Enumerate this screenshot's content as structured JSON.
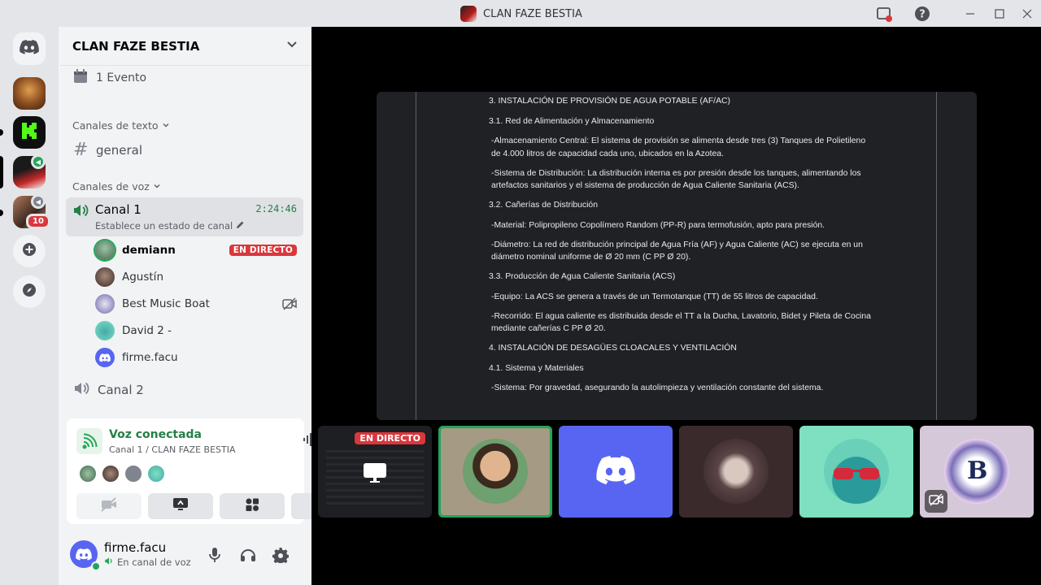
{
  "window": {
    "title": "CLAN FAZE BESTIA"
  },
  "server": {
    "name": "CLAN FAZE BESTIA",
    "events": "1 Evento",
    "text_category": "Canales de texto",
    "text_channels": [
      {
        "name": "general"
      }
    ],
    "voice_category": "Canales de voz",
    "voice_channels": [
      {
        "name": "Canal 1",
        "status": "Establece un estado de canal",
        "elapsed": "2:24:46"
      },
      {
        "name": "Canal 2"
      }
    ],
    "members": [
      {
        "name": "demiann",
        "live": "EN DIRECTO",
        "speaking": true
      },
      {
        "name": "Agustín"
      },
      {
        "name": "Best Music Boat",
        "video_off": true
      },
      {
        "name": "David 2 -"
      },
      {
        "name": "firme.facu"
      }
    ]
  },
  "rail": {
    "unread_badge": "10"
  },
  "voice_panel": {
    "title": "Voz conectada",
    "subtitle": "Canal 1 / CLAN FAZE BESTIA"
  },
  "user": {
    "name": "firme.facu",
    "status": "En canal de voz"
  },
  "stage": {
    "live_label": "EN DIRECTO",
    "document_lines": [
      "3. INSTALACIÓN DE PROVISIÓN DE AGUA POTABLE (AF/AC)",
      "3.1. Red de Alimentación y Almacenamiento",
      "-Almacenamiento Central: El sistema de provisión se alimenta desde tres (3) Tanques de Polietileno de 4.000 litros de capacidad cada uno, ubicados en la Azotea.",
      "-Sistema de Distribución: La distribución interna es por presión desde los tanques, alimentando los artefactos sanitarios y el sistema de producción de Agua Caliente Sanitaria (ACS).",
      "3.2. Cañerías de Distribución",
      "-Material: Polipropileno Copolímero Random (PP-R) para termofusión, apto para presión.",
      "-Diámetro: La red de distribución principal de Agua Fría (AF) y Agua Caliente (AC) se ejecuta en un diámetro nominal uniforme de Ø 20 mm (C PP Ø 20).",
      "3.3. Producción de Agua Caliente Sanitaria (ACS)",
      "-Equipo: La ACS se genera a través de un Termotanque (TT) de 55 litros de capacidad.",
      "-Recorrido: El agua caliente es distribuida desde el TT a la Ducha, Lavatorio, Bidet y Pileta de Cocina mediante cañerías C PP Ø 20.",
      "4. INSTALACIÓN DE DESAGÜES CLOACALES Y VENTILACIÓN",
      "4.1. Sistema y Materiales",
      "-Sistema: Por gravedad, asegurando la autolimpieza y ventilación constante del sistema."
    ]
  },
  "colors": {
    "accent": "#5865f2",
    "live": "#da373c",
    "connected": "#248046",
    "speaking": "#23a559"
  }
}
